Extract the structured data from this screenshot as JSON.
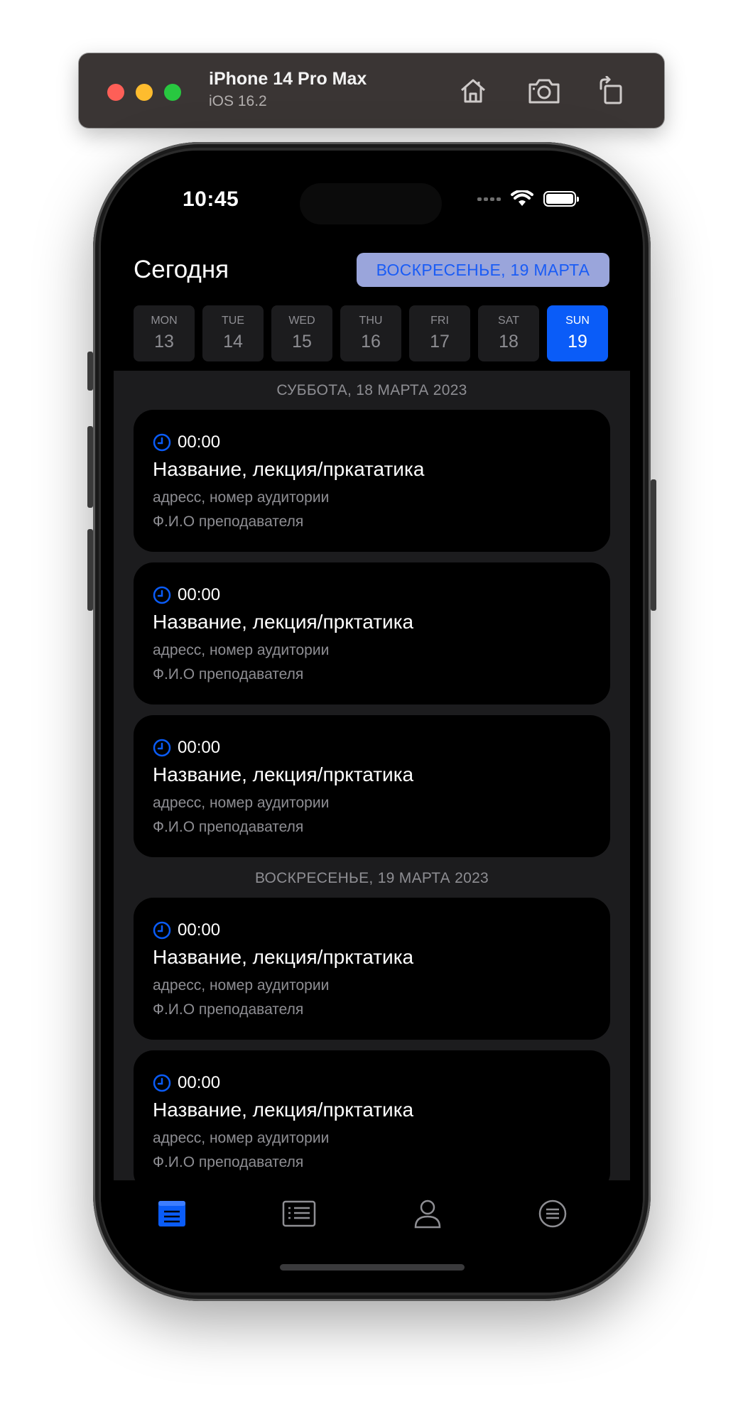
{
  "simulator": {
    "device_name": "iPhone 14 Pro Max",
    "os_version": "iOS 16.2",
    "icons": [
      "home-icon",
      "screenshot-icon",
      "rotate-icon"
    ]
  },
  "status_bar": {
    "time": "10:45"
  },
  "header": {
    "title": "Сегодня",
    "selected_date": "ВОСКРЕСЕНЬЕ, 19 МАРТА"
  },
  "week": [
    {
      "name": "MON",
      "num": "13",
      "selected": false
    },
    {
      "name": "TUE",
      "num": "14",
      "selected": false
    },
    {
      "name": "WED",
      "num": "15",
      "selected": false
    },
    {
      "name": "THU",
      "num": "16",
      "selected": false
    },
    {
      "name": "FRI",
      "num": "17",
      "selected": false
    },
    {
      "name": "SAT",
      "num": "18",
      "selected": false
    },
    {
      "name": "SUN",
      "num": "19",
      "selected": true
    }
  ],
  "sections": [
    {
      "header": "СУББОТА, 18 МАРТА 2023",
      "lessons": [
        {
          "time": "00:00",
          "title": "Название, лекция/прката­тика",
          "address": "адресс, номер аудитории",
          "teacher": "Ф.И.О преподавателя"
        },
        {
          "time": "00:00",
          "title": "Название, лекция/прктатика",
          "address": "адресс, номер аудитории",
          "teacher": "Ф.И.О преподавателя"
        },
        {
          "time": "00:00",
          "title": "Название, лекция/прктатика",
          "address": "адресс, номер аудитории",
          "teacher": "Ф.И.О преподавателя"
        }
      ]
    },
    {
      "header": "ВОСКРЕСЕНЬЕ, 19 МАРТА 2023",
      "lessons": [
        {
          "time": "00:00",
          "title": "Название, лекция/прктатика",
          "address": "адресс, номер аудитории",
          "teacher": "Ф.И.О преподавателя"
        },
        {
          "time": "00:00",
          "title": "Название, лекция/прктатика",
          "address": "адресс, номер аудитории",
          "teacher": "Ф.И.О преподавателя"
        }
      ]
    }
  ],
  "tab_bar": {
    "tabs": [
      "schedule-tab-icon",
      "list-tab-icon",
      "profile-tab-icon",
      "menu-tab-icon"
    ],
    "active_index": 0
  },
  "colors": {
    "accent": "#0a5cf8",
    "chip_bg": "#9aa5db",
    "list_bg": "#1c1c1e",
    "secondary_text": "#8e8e93"
  }
}
